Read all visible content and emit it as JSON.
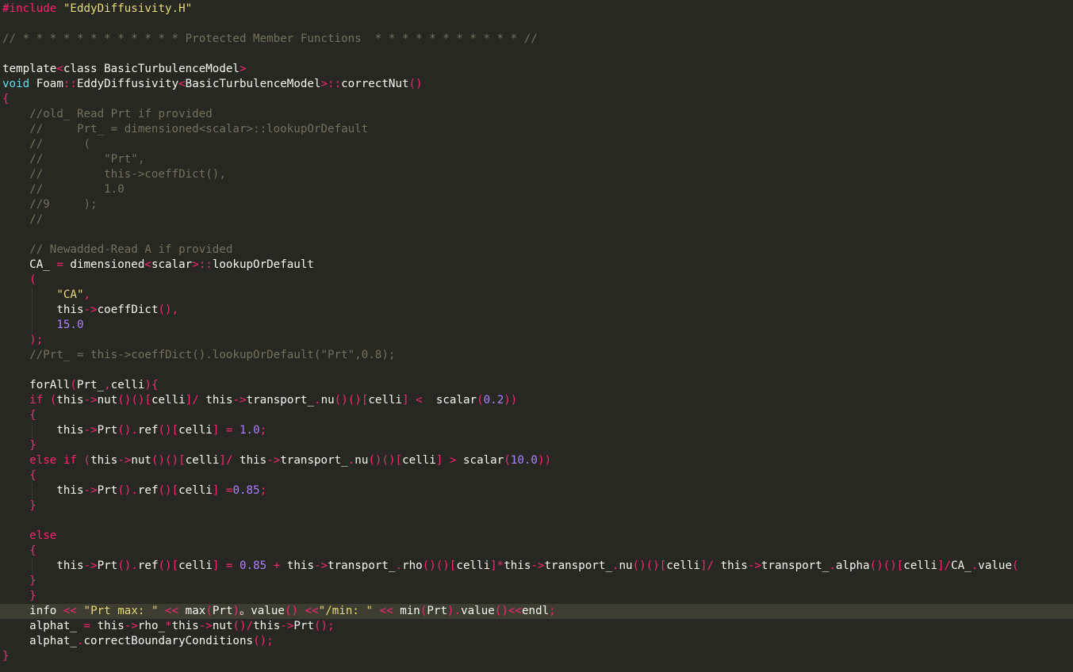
{
  "editor": {
    "theme_colors": {
      "background": "#272822",
      "current_line": "#3e3d32",
      "text": "#f8f8f2",
      "keyword": "#f92672",
      "type": "#66d9ef",
      "string": "#e6db74",
      "number": "#ae81ff",
      "comment": "#75715e"
    },
    "current_line_index": 40,
    "lines": [
      {
        "indent": 0,
        "tokens": [
          [
            "kw",
            "#include "
          ],
          [
            "st",
            "\"EddyDiffusivity.H\""
          ]
        ]
      },
      {
        "indent": 0,
        "tokens": []
      },
      {
        "indent": 0,
        "tokens": [
          [
            "cm",
            "// * * * * * * * * * * * * Protected Member Functions  * * * * * * * * * * * //"
          ]
        ]
      },
      {
        "indent": 0,
        "tokens": []
      },
      {
        "indent": 0,
        "tokens": [
          [
            "tx",
            "template"
          ],
          [
            "op",
            "<"
          ],
          [
            "tx",
            "class BasicTurbulenceModel"
          ],
          [
            "op",
            ">"
          ]
        ]
      },
      {
        "indent": 0,
        "tokens": [
          [
            "ty",
            "void"
          ],
          [
            "tx",
            " Foam"
          ],
          [
            "op",
            "::"
          ],
          [
            "tx",
            "EddyDiffusivity"
          ],
          [
            "op",
            "<"
          ],
          [
            "tx",
            "BasicTurbulenceModel"
          ],
          [
            "op",
            ">::"
          ],
          [
            "tx",
            "correctNut"
          ],
          [
            "op",
            "()"
          ]
        ]
      },
      {
        "indent": 0,
        "tokens": [
          [
            "op",
            "{"
          ]
        ]
      },
      {
        "indent": 4,
        "tokens": [
          [
            "cm",
            "//old_ Read Prt if provided"
          ]
        ]
      },
      {
        "indent": 4,
        "tokens": [
          [
            "cm",
            "//     Prt_ = dimensioned<scalar>::lookupOrDefault"
          ]
        ]
      },
      {
        "indent": 4,
        "tokens": [
          [
            "cm",
            "//      ("
          ]
        ]
      },
      {
        "indent": 4,
        "tokens": [
          [
            "cm",
            "//         \"Prt\","
          ]
        ]
      },
      {
        "indent": 4,
        "tokens": [
          [
            "cm",
            "//         this->coeffDict(),"
          ]
        ]
      },
      {
        "indent": 4,
        "tokens": [
          [
            "cm",
            "//         1.0"
          ]
        ]
      },
      {
        "indent": 4,
        "tokens": [
          [
            "cm",
            "//9     );"
          ]
        ]
      },
      {
        "indent": 4,
        "tokens": [
          [
            "cm",
            "//"
          ]
        ]
      },
      {
        "indent": 0,
        "tokens": []
      },
      {
        "indent": 4,
        "tokens": [
          [
            "cm",
            "// Newadded-Read A if provided"
          ]
        ]
      },
      {
        "indent": 4,
        "tokens": [
          [
            "tx",
            "CA_ "
          ],
          [
            "op",
            "="
          ],
          [
            "tx",
            " dimensioned"
          ],
          [
            "op",
            "<"
          ],
          [
            "tx",
            "scalar"
          ],
          [
            "op",
            ">::"
          ],
          [
            "tx",
            "lookupOrDefault"
          ]
        ]
      },
      {
        "indent": 4,
        "tokens": [
          [
            "op",
            "("
          ]
        ]
      },
      {
        "indent": 8,
        "tokens": [
          [
            "st",
            "\"CA\""
          ],
          [
            "op",
            ","
          ]
        ]
      },
      {
        "indent": 8,
        "tokens": [
          [
            "tx",
            "this"
          ],
          [
            "op",
            "->"
          ],
          [
            "tx",
            "coeffDict"
          ],
          [
            "op",
            "(),"
          ]
        ]
      },
      {
        "indent": 8,
        "tokens": [
          [
            "nu",
            "15.0"
          ]
        ]
      },
      {
        "indent": 4,
        "tokens": [
          [
            "op",
            ");"
          ]
        ]
      },
      {
        "indent": 4,
        "tokens": [
          [
            "cm",
            "//Prt_ = this->coeffDict().lookupOrDefault(\"Prt\",0.8);"
          ]
        ]
      },
      {
        "indent": 0,
        "tokens": []
      },
      {
        "indent": 4,
        "tokens": [
          [
            "tx",
            "forAll"
          ],
          [
            "op",
            "("
          ],
          [
            "tx",
            "Prt_"
          ],
          [
            "op",
            ","
          ],
          [
            "tx",
            "celli"
          ],
          [
            "op",
            "){"
          ]
        ]
      },
      {
        "indent": 4,
        "tokens": [
          [
            "kw",
            "if"
          ],
          [
            "tx",
            " "
          ],
          [
            "op",
            "("
          ],
          [
            "tx",
            "this"
          ],
          [
            "op",
            "->"
          ],
          [
            "tx",
            "nut"
          ],
          [
            "op",
            "()()["
          ],
          [
            "tx",
            "celli"
          ],
          [
            "op",
            "]/"
          ],
          [
            "tx",
            " this"
          ],
          [
            "op",
            "->"
          ],
          [
            "tx",
            "transport_"
          ],
          [
            "op",
            "."
          ],
          [
            "tx",
            "nu"
          ],
          [
            "op",
            "()()["
          ],
          [
            "tx",
            "celli"
          ],
          [
            "op",
            "]"
          ],
          [
            "tx",
            " "
          ],
          [
            "op",
            "<"
          ],
          [
            "tx",
            "  scalar"
          ],
          [
            "op",
            "("
          ],
          [
            "nu",
            "0.2"
          ],
          [
            "op",
            "))"
          ]
        ]
      },
      {
        "indent": 4,
        "tokens": [
          [
            "op",
            "{"
          ]
        ]
      },
      {
        "indent": 8,
        "tokens": [
          [
            "tx",
            "this"
          ],
          [
            "op",
            "->"
          ],
          [
            "tx",
            "Prt"
          ],
          [
            "op",
            "()."
          ],
          [
            "tx",
            "ref"
          ],
          [
            "op",
            "()["
          ],
          [
            "tx",
            "celli"
          ],
          [
            "op",
            "]"
          ],
          [
            "tx",
            " "
          ],
          [
            "op",
            "="
          ],
          [
            "tx",
            " "
          ],
          [
            "nu",
            "1.0"
          ],
          [
            "op",
            ";"
          ]
        ]
      },
      {
        "indent": 4,
        "tokens": [
          [
            "op",
            "}"
          ]
        ]
      },
      {
        "indent": 4,
        "tokens": [
          [
            "kw",
            "else"
          ],
          [
            "tx",
            " "
          ],
          [
            "kw",
            "if"
          ],
          [
            "tx",
            " "
          ],
          [
            "op",
            "("
          ],
          [
            "tx",
            "this"
          ],
          [
            "op",
            "->"
          ],
          [
            "tx",
            "nut"
          ],
          [
            "op",
            "()()["
          ],
          [
            "tx",
            "celli"
          ],
          [
            "op",
            "]/"
          ],
          [
            "tx",
            " this"
          ],
          [
            "op",
            "->"
          ],
          [
            "tx",
            "transport_"
          ],
          [
            "op",
            "."
          ],
          [
            "tx",
            "nu"
          ],
          [
            "op",
            "()()["
          ],
          [
            "tx",
            "celli"
          ],
          [
            "op",
            "]"
          ],
          [
            "tx",
            " "
          ],
          [
            "op",
            ">"
          ],
          [
            "tx",
            " scalar"
          ],
          [
            "op",
            "("
          ],
          [
            "nu",
            "10.0"
          ],
          [
            "op",
            "))"
          ]
        ]
      },
      {
        "indent": 4,
        "tokens": [
          [
            "op",
            "{"
          ]
        ]
      },
      {
        "indent": 8,
        "tokens": [
          [
            "tx",
            "this"
          ],
          [
            "op",
            "->"
          ],
          [
            "tx",
            "Prt"
          ],
          [
            "op",
            "()."
          ],
          [
            "tx",
            "ref"
          ],
          [
            "op",
            "()["
          ],
          [
            "tx",
            "celli"
          ],
          [
            "op",
            "]"
          ],
          [
            "tx",
            " "
          ],
          [
            "op",
            "="
          ],
          [
            "nu",
            "0.85"
          ],
          [
            "op",
            ";"
          ]
        ]
      },
      {
        "indent": 4,
        "tokens": [
          [
            "op",
            "}"
          ]
        ]
      },
      {
        "indent": 0,
        "tokens": []
      },
      {
        "indent": 4,
        "tokens": [
          [
            "kw",
            "else"
          ]
        ]
      },
      {
        "indent": 4,
        "tokens": [
          [
            "op",
            "{"
          ]
        ]
      },
      {
        "indent": 8,
        "tokens": [
          [
            "tx",
            "this"
          ],
          [
            "op",
            "->"
          ],
          [
            "tx",
            "Prt"
          ],
          [
            "op",
            "()."
          ],
          [
            "tx",
            "ref"
          ],
          [
            "op",
            "()["
          ],
          [
            "tx",
            "celli"
          ],
          [
            "op",
            "]"
          ],
          [
            "tx",
            " "
          ],
          [
            "op",
            "="
          ],
          [
            "tx",
            " "
          ],
          [
            "nu",
            "0.85"
          ],
          [
            "tx",
            " "
          ],
          [
            "op",
            "+"
          ],
          [
            "tx",
            " this"
          ],
          [
            "op",
            "->"
          ],
          [
            "tx",
            "transport_"
          ],
          [
            "op",
            "."
          ],
          [
            "tx",
            "rho"
          ],
          [
            "op",
            "()()["
          ],
          [
            "tx",
            "celli"
          ],
          [
            "op",
            "]*"
          ],
          [
            "tx",
            "this"
          ],
          [
            "op",
            "->"
          ],
          [
            "tx",
            "transport_"
          ],
          [
            "op",
            "."
          ],
          [
            "tx",
            "nu"
          ],
          [
            "op",
            "()()["
          ],
          [
            "tx",
            "celli"
          ],
          [
            "op",
            "]/"
          ],
          [
            "tx",
            " this"
          ],
          [
            "op",
            "->"
          ],
          [
            "tx",
            "transport_"
          ],
          [
            "op",
            "."
          ],
          [
            "tx",
            "alpha"
          ],
          [
            "op",
            "()()["
          ],
          [
            "tx",
            "celli"
          ],
          [
            "op",
            "]/"
          ],
          [
            "tx",
            "CA_"
          ],
          [
            "op",
            "."
          ],
          [
            "tx",
            "value"
          ],
          [
            "op",
            "("
          ]
        ]
      },
      {
        "indent": 4,
        "tokens": [
          [
            "op",
            "}"
          ]
        ]
      },
      {
        "indent": 4,
        "tokens": [
          [
            "op",
            "}"
          ]
        ]
      },
      {
        "indent": 4,
        "tokens": [
          [
            "tx",
            "info "
          ],
          [
            "op",
            "<<"
          ],
          [
            "tx",
            " "
          ],
          [
            "st",
            "\"Prt max: \""
          ],
          [
            "tx",
            " "
          ],
          [
            "op",
            "<<"
          ],
          [
            "tx",
            " max"
          ],
          [
            "op",
            "("
          ],
          [
            "tx",
            "Prt"
          ],
          [
            "op",
            ")"
          ],
          [
            "tx",
            "。value"
          ],
          [
            "op",
            "()"
          ],
          [
            "tx",
            " "
          ],
          [
            "op",
            "<<"
          ],
          [
            "st",
            "\"/min: \""
          ],
          [
            "tx",
            " "
          ],
          [
            "op",
            "<<"
          ],
          [
            "tx",
            " min"
          ],
          [
            "op",
            "("
          ],
          [
            "tx",
            "Prt"
          ],
          [
            "op",
            ")."
          ],
          [
            "tx",
            "value"
          ],
          [
            "op",
            "()<<"
          ],
          [
            "tx",
            "endl"
          ],
          [
            "op",
            ";"
          ]
        ]
      },
      {
        "indent": 4,
        "tokens": [
          [
            "tx",
            "alphat_ "
          ],
          [
            "op",
            "="
          ],
          [
            "tx",
            " this"
          ],
          [
            "op",
            "->"
          ],
          [
            "tx",
            "rho_"
          ],
          [
            "op",
            "*"
          ],
          [
            "tx",
            "this"
          ],
          [
            "op",
            "->"
          ],
          [
            "tx",
            "nut"
          ],
          [
            "op",
            "()/"
          ],
          [
            "tx",
            "this"
          ],
          [
            "op",
            "->"
          ],
          [
            "tx",
            "Prt"
          ],
          [
            "op",
            "();"
          ]
        ]
      },
      {
        "indent": 4,
        "tokens": [
          [
            "tx",
            "alphat_"
          ],
          [
            "op",
            "."
          ],
          [
            "tx",
            "correctBoundaryConditions"
          ],
          [
            "op",
            "();"
          ]
        ]
      },
      {
        "indent": 0,
        "tokens": [
          [
            "op",
            "}"
          ]
        ]
      }
    ]
  }
}
